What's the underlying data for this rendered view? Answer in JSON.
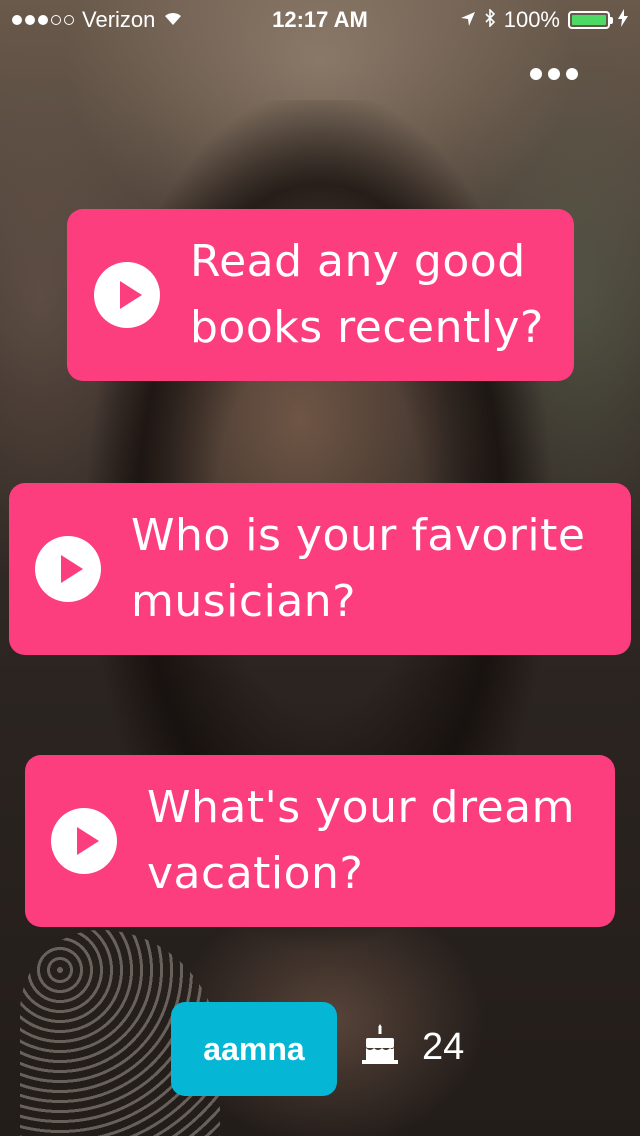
{
  "status_bar": {
    "carrier": "Verizon",
    "time": "12:17 AM",
    "battery": "100%"
  },
  "questions": [
    {
      "line1": "Read any good",
      "line2": "books recently?"
    },
    {
      "line1": "Who is your favorite",
      "line2": "musician?"
    },
    {
      "line1": "What's your dream",
      "line2": "vacation?"
    }
  ],
  "profile": {
    "name": "aamna",
    "age": "24"
  },
  "colors": {
    "card": "#fc3d7e",
    "badge": "#05b7d4",
    "battery": "#4cd964"
  },
  "icons": [
    "signal-icon",
    "wifi-icon",
    "location-icon",
    "bluetooth-icon",
    "battery-icon",
    "more-icon",
    "play-icon",
    "cake-icon"
  ]
}
